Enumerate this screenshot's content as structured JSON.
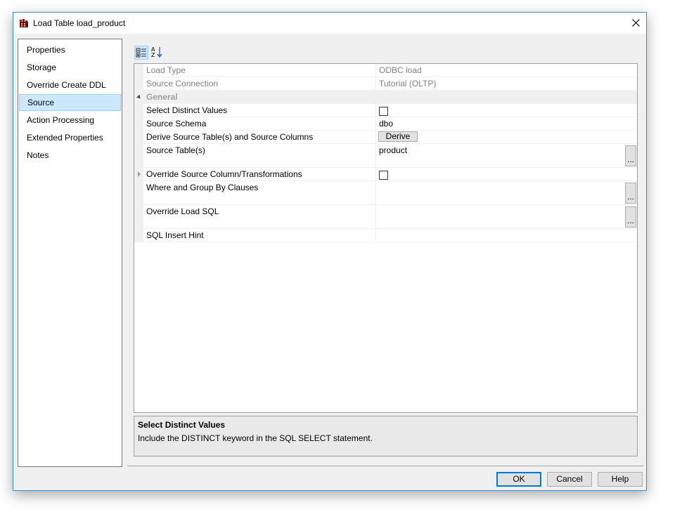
{
  "window": {
    "title": "Load Table load_product"
  },
  "nav": {
    "items": [
      {
        "label": "Properties"
      },
      {
        "label": "Storage"
      },
      {
        "label": "Override Create DDL"
      },
      {
        "label": "Source"
      },
      {
        "label": "Action Processing"
      },
      {
        "label": "Extended Properties"
      },
      {
        "label": "Notes"
      }
    ],
    "selected": "Source"
  },
  "toolbar": {
    "categorized_icon": "categorized-view-icon",
    "alphabetical_icon": "sort-alphabetical-icon"
  },
  "grid": {
    "rows": [
      {
        "label": "Load Type",
        "value": "ODBC load"
      },
      {
        "label": "Source Connection",
        "value": "Tutorial (OLTP)"
      },
      {
        "category": "General"
      },
      {
        "label": "Select Distinct Values",
        "checked": false
      },
      {
        "label": "Source Schema",
        "value": "dbo"
      },
      {
        "label": "Derive Source Table(s) and Source Columns",
        "button": "Derive"
      },
      {
        "label": "Source Table(s)",
        "value": "product",
        "ellipsis": "..."
      },
      {
        "label": "Override Source Column/Transformations",
        "checked": false
      },
      {
        "label": "Where and Group By Clauses",
        "value": "",
        "ellipsis": "..."
      },
      {
        "label": "Override Load SQL",
        "value": "",
        "ellipsis": "..."
      },
      {
        "label": "SQL Insert Hint",
        "value": ""
      }
    ]
  },
  "help": {
    "title": "Select Distinct Values",
    "description": "Include the DISTINCT keyword in the SQL SELECT statement."
  },
  "buttons": {
    "ok": "OK",
    "cancel": "Cancel",
    "help": "Help"
  },
  "colors": {
    "selection": "#cce8ff",
    "accent": "#0078d7"
  }
}
